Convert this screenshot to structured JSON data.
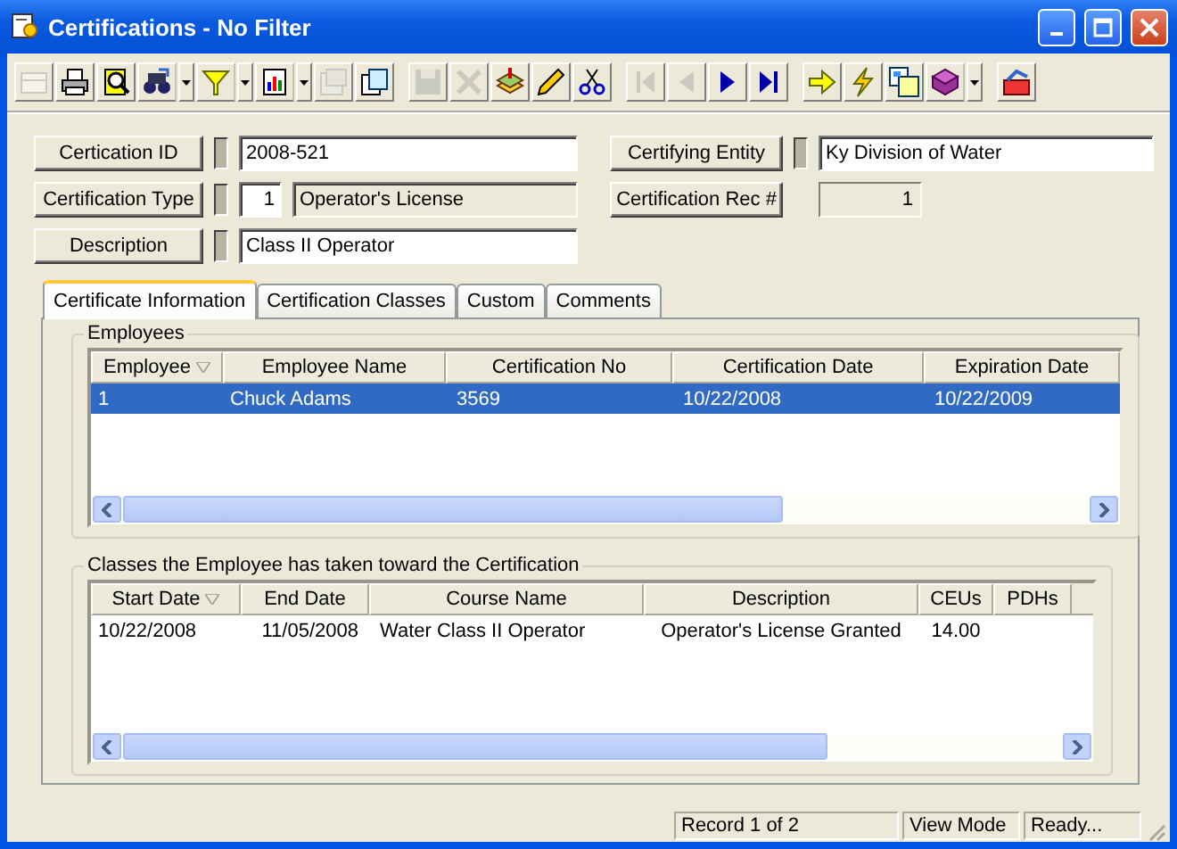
{
  "window": {
    "title": "Certifications - No Filter"
  },
  "toolbar": [
    [
      {
        "disabled": true,
        "dropdown": false
      },
      {
        "disabled": false,
        "dropdown": false
      },
      {
        "disabled": false,
        "dropdown": false
      },
      {
        "disabled": false,
        "dropdown": true
      },
      {
        "disabled": false,
        "dropdown": true
      },
      {
        "disabled": false,
        "dropdown": true
      },
      {
        "disabled": true,
        "dropdown": false
      },
      {
        "disabled": false,
        "dropdown": false
      }
    ],
    [
      {
        "disabled": true,
        "dropdown": false
      },
      {
        "disabled": true,
        "dropdown": false
      },
      {
        "disabled": false,
        "dropdown": false
      },
      {
        "disabled": false,
        "dropdown": false
      },
      {
        "disabled": false,
        "dropdown": false
      }
    ],
    [
      {
        "disabled": true,
        "dropdown": false
      },
      {
        "disabled": true,
        "dropdown": false
      },
      {
        "disabled": false,
        "dropdown": false
      },
      {
        "disabled": false,
        "dropdown": false
      }
    ],
    [
      {
        "disabled": false,
        "dropdown": false
      },
      {
        "disabled": false,
        "dropdown": false
      },
      {
        "disabled": false,
        "dropdown": false
      },
      {
        "disabled": false,
        "dropdown": true
      }
    ],
    [
      {
        "disabled": false,
        "dropdown": false
      }
    ]
  ],
  "fields": {
    "left": [
      {
        "label": "Certication ID",
        "kind": "text",
        "value": "2008-521"
      },
      {
        "label": "Certification Type",
        "kind": "coded",
        "code": "1",
        "value": "Operator's License"
      },
      {
        "label": "Description",
        "kind": "text",
        "value": "Class II Operator"
      }
    ],
    "right": [
      {
        "label": "Certifying Entity",
        "kind": "text",
        "value": "Ky Division of Water"
      },
      {
        "label": "Certification Rec #",
        "kind": "readonly",
        "value": "1"
      }
    ]
  },
  "tabs": [
    {
      "label": "Certificate Information",
      "selected": true
    },
    {
      "label": "Certification Classes",
      "selected": false
    },
    {
      "label": "Custom",
      "selected": false
    },
    {
      "label": "Comments",
      "selected": false
    }
  ],
  "employees": {
    "title": "Employees",
    "columns": [
      {
        "label": "Employee",
        "sorted": true
      },
      {
        "label": "Employee Name",
        "sorted": false
      },
      {
        "label": "Certification No",
        "sorted": false
      },
      {
        "label": "Certification Date",
        "sorted": false
      },
      {
        "label": "Expiration Date",
        "sorted": false
      }
    ],
    "rows": [
      {
        "selected": true,
        "cells": [
          "1",
          "Chuck Adams",
          "3569",
          "10/22/2008",
          "10/22/2009"
        ]
      }
    ]
  },
  "classes": {
    "title": "Classes the Employee has taken toward the Certification",
    "columns": [
      {
        "label": "Start Date",
        "sorted": true
      },
      {
        "label": "End Date",
        "sorted": false
      },
      {
        "label": "Course Name",
        "sorted": false
      },
      {
        "label": "Description",
        "sorted": false
      },
      {
        "label": "CEUs",
        "sorted": false
      },
      {
        "label": "PDHs",
        "sorted": false
      }
    ],
    "rows": [
      {
        "selected": false,
        "cells": [
          "10/22/2008",
          "11/05/2008",
          "Water Class II Operator",
          "Operator's License Granted",
          "14.00",
          ""
        ]
      }
    ]
  },
  "status_bar": [
    "Record 1 of 2",
    "View Mode",
    "Ready..."
  ]
}
